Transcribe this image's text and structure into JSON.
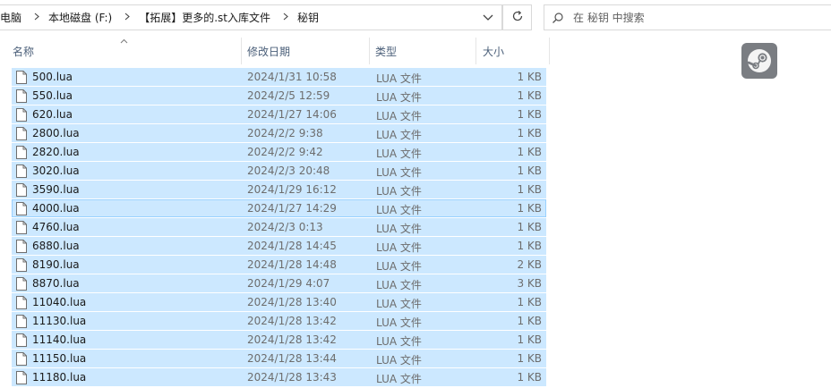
{
  "address_bar": {
    "crumbs": [
      "电脑",
      "本地磁盘 (F:)",
      "【拓展】更多的.st入库文件",
      "秘钥"
    ]
  },
  "search": {
    "placeholder": "在 秘钥 中搜索"
  },
  "columns": {
    "name": "名称",
    "date": "修改日期",
    "type": "类型",
    "size": "大小"
  },
  "files": [
    {
      "name": "500.lua",
      "date": "2024/1/31 10:58",
      "type": "LUA 文件",
      "size": "1 KB"
    },
    {
      "name": "550.lua",
      "date": "2024/2/5 12:59",
      "type": "LUA 文件",
      "size": "1 KB"
    },
    {
      "name": "620.lua",
      "date": "2024/1/27 14:06",
      "type": "LUA 文件",
      "size": "1 KB"
    },
    {
      "name": "2800.lua",
      "date": "2024/2/2 9:38",
      "type": "LUA 文件",
      "size": "1 KB"
    },
    {
      "name": "2820.lua",
      "date": "2024/2/2 9:42",
      "type": "LUA 文件",
      "size": "1 KB"
    },
    {
      "name": "3020.lua",
      "date": "2024/2/3 20:48",
      "type": "LUA 文件",
      "size": "1 KB"
    },
    {
      "name": "3590.lua",
      "date": "2024/1/29 16:12",
      "type": "LUA 文件",
      "size": "1 KB"
    },
    {
      "name": "4000.lua",
      "date": "2024/1/27 14:29",
      "type": "LUA 文件",
      "size": "1 KB"
    },
    {
      "name": "4760.lua",
      "date": "2024/2/3 0:13",
      "type": "LUA 文件",
      "size": "1 KB"
    },
    {
      "name": "6880.lua",
      "date": "2024/1/28 14:45",
      "type": "LUA 文件",
      "size": "1 KB"
    },
    {
      "name": "8190.lua",
      "date": "2024/1/28 14:48",
      "type": "LUA 文件",
      "size": "2 KB"
    },
    {
      "name": "8870.lua",
      "date": "2024/1/29 4:07",
      "type": "LUA 文件",
      "size": "3 KB"
    },
    {
      "name": "11040.lua",
      "date": "2024/1/28 13:40",
      "type": "LUA 文件",
      "size": "1 KB"
    },
    {
      "name": "11130.lua",
      "date": "2024/1/28 13:42",
      "type": "LUA 文件",
      "size": "1 KB"
    },
    {
      "name": "11140.lua",
      "date": "2024/1/28 13:42",
      "type": "LUA 文件",
      "size": "1 KB"
    },
    {
      "name": "11150.lua",
      "date": "2024/1/28 13:44",
      "type": "LUA 文件",
      "size": "1 KB"
    },
    {
      "name": "11180.lua",
      "date": "2024/1/28 13:43",
      "type": "LUA 文件",
      "size": "1 KB"
    }
  ],
  "focused_index": 7,
  "icons": {
    "file": "file-icon",
    "dropdown": "chevron-down-icon",
    "refresh": "refresh-icon",
    "search": "search-icon",
    "preview": "steam-logo-icon",
    "sort": "sort-up-icon"
  },
  "colors": {
    "selection": "#cce8ff",
    "focus_border": "#99d1ff",
    "header_text": "#4c607a"
  }
}
